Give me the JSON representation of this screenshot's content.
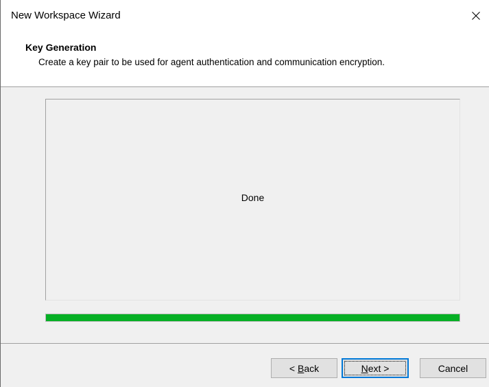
{
  "window": {
    "title": "New Workspace Wizard",
    "close_icon": "close-icon"
  },
  "header": {
    "title": "Key Generation",
    "description": "Create a key pair to be used for agent authentication and communication encryption."
  },
  "content": {
    "status_text": "Done",
    "progress_percent": 100,
    "progress_color": "#06b025"
  },
  "buttons": {
    "back": {
      "prefix": "< ",
      "mnemonic": "B",
      "rest": "ack"
    },
    "next": {
      "mnemonic": "N",
      "rest": "ext >"
    },
    "cancel": {
      "label": "Cancel"
    }
  }
}
